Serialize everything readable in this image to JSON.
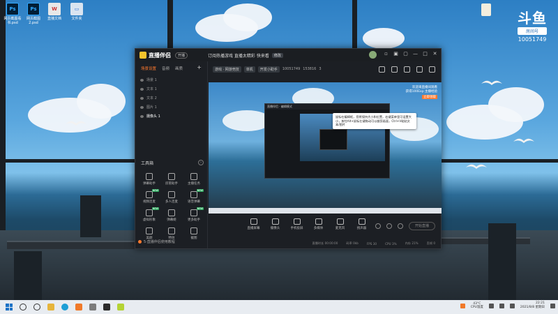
{
  "desktop": {
    "icons": [
      {
        "label": "网页截图看书.psd",
        "glyph": "Ps",
        "kind": "ps"
      },
      {
        "label": "网页截图2.psd",
        "glyph": "Ps",
        "kind": "ps"
      },
      {
        "label": "直播文档",
        "glyph": "W",
        "kind": "doc"
      },
      {
        "label": "文件夹",
        "glyph": "▭",
        "kind": "folder"
      }
    ],
    "logo": {
      "mark": "斗鱼",
      "room_label": "房间号",
      "room_number": "10051749"
    }
  },
  "app": {
    "name": "直播伴侣",
    "name_button": "开播",
    "title": "订阅热播游戏 直播太精彩 快来看",
    "title_badge": "修改",
    "window_controls": [
      "▫",
      "▣",
      "▢",
      "—",
      "□",
      "✕"
    ],
    "sidebar": {
      "tabs": [
        "场景设置",
        "音频",
        "画质"
      ],
      "active_tab": "场景设置",
      "add": "+",
      "scenes": [
        {
          "label": "场景 1",
          "active": false
        },
        {
          "label": "文本 1",
          "active": false
        },
        {
          "label": "文本 2",
          "active": false
        },
        {
          "label": "图片 1",
          "active": false
        },
        {
          "label": "摄像头 1",
          "active": true
        }
      ],
      "tools_title": "工具箱",
      "tools_more": "›",
      "tools": [
        {
          "label": "弹幕助手",
          "badge": ""
        },
        {
          "label": "房管助手",
          "badge": ""
        },
        {
          "label": "主播任务",
          "badge": ""
        },
        {
          "label": "视频连麦",
          "badge": "NEW"
        },
        {
          "label": "多人连麦",
          "badge": ""
        },
        {
          "label": "语音弹幕",
          "badge": "NEW"
        },
        {
          "label": "虚拟形象",
          "badge": "NEW"
        },
        {
          "label": "弹幕姬",
          "badge": ""
        },
        {
          "label": "更多助手",
          "badge": "NEW"
        },
        {
          "label": "美颜",
          "badge": ""
        },
        {
          "label": "特效",
          "badge": ""
        },
        {
          "label": "截图",
          "badge": ""
        }
      ],
      "notice": "5·直播伴侣使用教程"
    },
    "room_bar": {
      "category": "游戏 · 网游竞技",
      "tag": "单机",
      "chip2": "开发小助手",
      "room": "10051749",
      "hot": "153816",
      "fans": "3"
    },
    "preview": {
      "info_line1": "欢迎来直播间观看",
      "info_line2": "获得100Exp 主播经验",
      "info_button": "立即领取",
      "nested_bar": "直播伴侣 · 编辑模式",
      "tooltip": "鼠标在编辑框，您将保持大小和位置，右键菜单里可设置大小，按住Alt+鼠标左键拖动可以裁剪画面，Ctrl+V粘贴文本/图片"
    },
    "dock": [
      {
        "label": "直播屏幕",
        "icon": "screen-icon"
      },
      {
        "label": "摄像头",
        "icon": "camera-icon"
      },
      {
        "label": "手机投屏",
        "icon": "phone-cast-icon"
      },
      {
        "label": "多媒体",
        "icon": "media-icon"
      },
      {
        "label": "麦克风",
        "icon": "mic-icon"
      },
      {
        "label": "扬声器",
        "icon": "speaker-icon"
      }
    ],
    "go_live": "开始直播",
    "status": [
      "直播时长 00:00:00",
      "码率 0kb",
      "FPS 30",
      "CPU 3%",
      "内存 21%",
      "丢帧 0"
    ]
  },
  "taskbar": {
    "temp_line1": "43°C",
    "temp_line2": "CPU温度",
    "time": "22:21",
    "date": "2021/8/8 星期日"
  }
}
